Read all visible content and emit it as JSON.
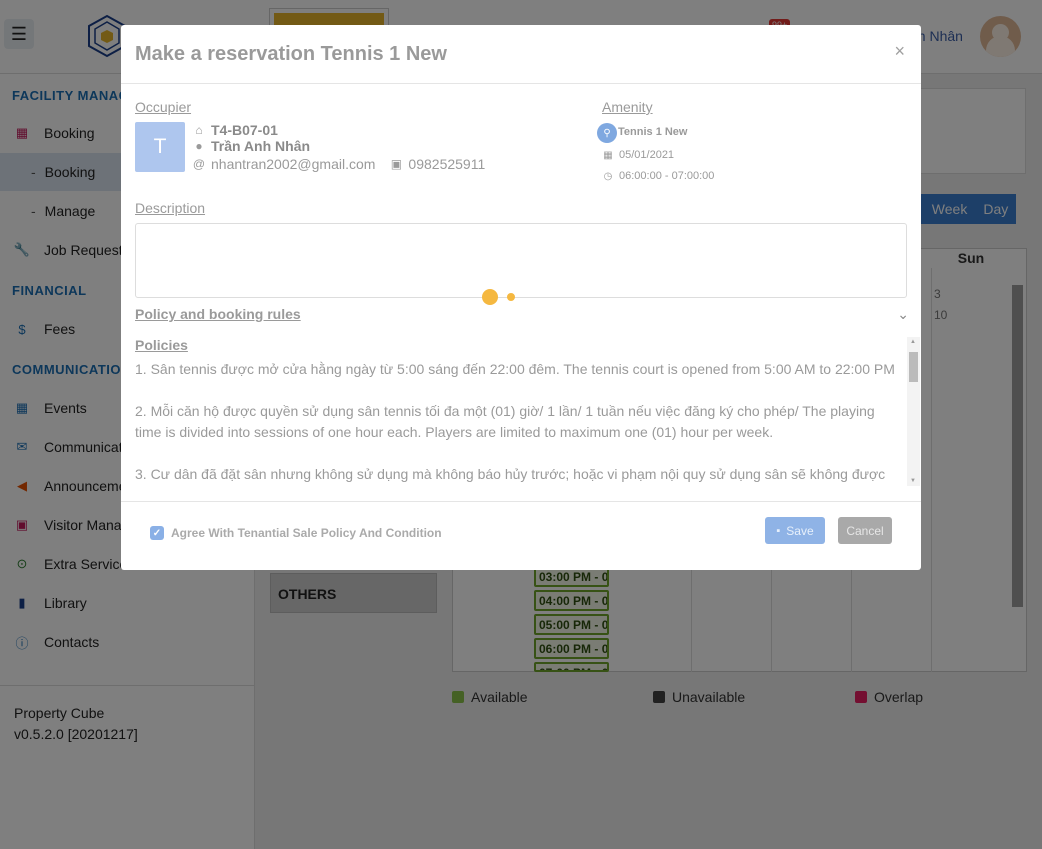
{
  "topbar": {
    "menu_icon": "hamburger-icon",
    "badge": "99+",
    "user_name": "nh Nhân"
  },
  "sidebar": {
    "sections": {
      "facility": "FACILITY MANAGE",
      "financial": "FINANCIAL",
      "communication": "COMMUNICATION"
    },
    "items": [
      {
        "label": "Booking",
        "icon": "calendar-plus-icon",
        "color": "#c2185b"
      },
      {
        "label": "Booking",
        "sub": true,
        "active": true
      },
      {
        "label": "Manage",
        "sub": true
      },
      {
        "label": "Job Request",
        "icon": "wrench-icon",
        "color": "#1b6fb5"
      },
      {
        "label": "Fees",
        "icon": "invoice-icon",
        "color": "#1b6fb5"
      },
      {
        "label": "Events",
        "icon": "calendar-icon",
        "color": "#1b6fb5"
      },
      {
        "label": "Communicati",
        "icon": "comments-icon",
        "color": "#1b6fb5"
      },
      {
        "label": "Announceme",
        "icon": "megaphone-icon",
        "color": "#e65100"
      },
      {
        "label": "Visitor Mana",
        "icon": "id-badge-icon",
        "color": "#c2185b"
      },
      {
        "label": "Extra Services",
        "icon": "search-dollar-icon",
        "color": "#2e7d32"
      },
      {
        "label": "Library",
        "icon": "book-icon",
        "color": "#1b3f8a"
      },
      {
        "label": "Contacts",
        "icon": "info-icon",
        "color": "#1b6fb5"
      }
    ],
    "footer": {
      "app": "Property Cube",
      "version": "v0.5.2.0 [20201217]"
    }
  },
  "calendar": {
    "views": [
      "n",
      "Week",
      "Day"
    ],
    "sunday": "Sun",
    "dates": [
      "3",
      "10"
    ],
    "slots": [
      "03:00 PM - 0",
      "04:00 PM - 0",
      "05:00 PM - 0",
      "06:00 PM - 0",
      "07:00 PM - 0"
    ],
    "others_tab": "OTHERS",
    "legend": [
      {
        "label": "Available",
        "color": "#8bc34a"
      },
      {
        "label": "Unavailable",
        "color": "#424242"
      },
      {
        "label": "Overlap",
        "color": "#e91e63"
      }
    ]
  },
  "modal": {
    "title": "Make a reservation Tennis 1 New",
    "close": "×",
    "occupier": {
      "label": "Occupier",
      "avatar_letter": "T",
      "unit": "T4-B07-01",
      "name": "Trần Anh Nhân",
      "email": "nhantran2002@gmail.com",
      "phone": "0982525911"
    },
    "amenity": {
      "label": "Amenity",
      "name": "Tennis 1 New",
      "date": "05/01/2021",
      "time": "06:00:00 - 07:00:00"
    },
    "description": {
      "label": "Description",
      "value": ""
    },
    "policy": {
      "header": "Policy and booking rules",
      "subheader": "Policies",
      "paragraphs": [
        "1. Sân tennis được mở cửa hằng ngày từ 5:00 sáng đến 22:00 đêm. The tennis court is opened from 5:00 AM to 22:00 PM",
        "2. Mỗi căn hộ được quyền sử dụng sân tennis tối đa một (01) giờ/ 1 lần/ 1 tuần nếu việc đăng ký cho phép/ The playing time is divided into sessions of one hour each. Players are limited to maximum one (01) hour per week.",
        "3. Cư dân đã đặt sân nhưng không sử dụng mà không báo hủy trước; hoặc vi phạm nội quy sử dụng sân sẽ không được"
      ]
    },
    "footer": {
      "agree": "Agree With Tenantial Sale Policy And Condition",
      "save": "Save",
      "cancel": "Cancel"
    }
  }
}
